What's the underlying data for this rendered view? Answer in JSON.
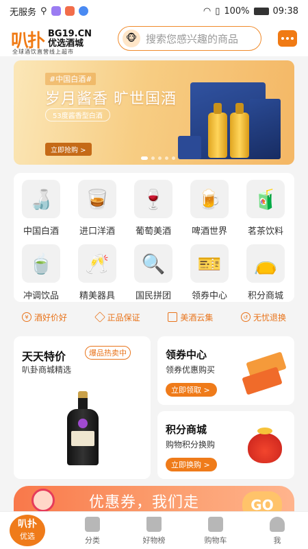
{
  "status": {
    "carrier": "无服务",
    "battery": "100%",
    "time": "09:38"
  },
  "header": {
    "logo_mark": "叭扑",
    "logo_domain": "BG19.CN",
    "logo_name": "优选酒城",
    "logo_slogan": "全球酒饮直营线上超市",
    "search_placeholder": "搜索您感兴趣的商品"
  },
  "banner": {
    "tag": "#中国白酒#",
    "title": "岁月酱香 旷世国酒",
    "subtitle": "53度酱香型白酒",
    "button": "立即抢购 >"
  },
  "categories": [
    {
      "label": "中国白酒",
      "icon": "baijiu-icon",
      "glyph": "🍶"
    },
    {
      "label": "进口洋酒",
      "icon": "whisky-icon",
      "glyph": "🥃"
    },
    {
      "label": "葡萄美酒",
      "icon": "wine-icon",
      "glyph": "🍷"
    },
    {
      "label": "啤酒世界",
      "icon": "beer-icon",
      "glyph": "🍺"
    },
    {
      "label": "茗茶饮料",
      "icon": "tea-drink-icon",
      "glyph": "🧃"
    },
    {
      "label": "冲调饮品",
      "icon": "tea-cup-icon",
      "glyph": "🍵"
    },
    {
      "label": "精美器具",
      "icon": "glassware-icon",
      "glyph": "🥂"
    },
    {
      "label": "国民拼团",
      "icon": "group-buy-icon",
      "glyph": "🔍"
    },
    {
      "label": "领券中心",
      "icon": "coupon-icon",
      "glyph": "🎫"
    },
    {
      "label": "积分商城",
      "icon": "lucky-bag-icon",
      "glyph": "👝"
    }
  ],
  "guarantees": [
    {
      "label": "酒好价好",
      "icon": "yen-icon"
    },
    {
      "label": "正品保证",
      "icon": "diamond-icon"
    },
    {
      "label": "美酒云集",
      "icon": "bottles-icon"
    },
    {
      "label": "无忧退换",
      "icon": "return-icon"
    }
  ],
  "deal": {
    "title": "天天特价",
    "badge": "爆品热卖中",
    "subtitle": "叭卦商城精选"
  },
  "coupon": {
    "title": "领券中心",
    "subtitle": "领券优惠购买",
    "button": "立即领取 >"
  },
  "points": {
    "title": "积分商城",
    "subtitle": "购物积分换购",
    "button": "立即换购 >"
  },
  "strip": {
    "text": "优惠券，我们走",
    "go": "GO"
  },
  "tabs": [
    {
      "label": "优选",
      "mark": "叭扑"
    },
    {
      "label": "分类"
    },
    {
      "label": "好物榜"
    },
    {
      "label": "购物车"
    },
    {
      "label": "我"
    }
  ],
  "colors": {
    "accent": "#ef7b1a",
    "background": "#f4f4f4"
  }
}
